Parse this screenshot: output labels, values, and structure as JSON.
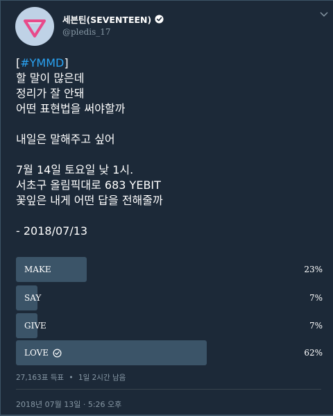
{
  "author": {
    "name": "세븐틴(SEVENTEEN)",
    "handle": "@pledis_17",
    "verified": true,
    "avatar_icon": "seventeen-triangle-logo-icon",
    "avatar_background": "#bfd2e6",
    "logo_color": "#e84a8a"
  },
  "menu": {
    "icon": "chevron-down-icon"
  },
  "tweet": {
    "hashtag_open": "[",
    "hashtag": "#YMMD",
    "hashtag_close": "]",
    "lines": [
      "할 말이 많은데",
      "정리가 잘 안돼",
      "어떤 표현법을 써야할까",
      "",
      "내일은 말해주고 싶어",
      "",
      "7월 14일 토요일 낮 1시.",
      "서초구 올림픽대로 683 YEBIT",
      "꽃잎은 내게 어떤 답을 전해줄까",
      "",
      "- 2018/07/13"
    ]
  },
  "poll": {
    "options": [
      {
        "label": "MAKE",
        "percent_text": "23%",
        "percent": 23,
        "selected": false
      },
      {
        "label": "SAY",
        "percent_text": "7%",
        "percent": 7,
        "selected": false
      },
      {
        "label": "GIVE",
        "percent_text": "7%",
        "percent": 7,
        "selected": false
      },
      {
        "label": "LOVE",
        "percent_text": "62%",
        "percent": 62,
        "selected": true
      }
    ],
    "votes": "27,163표 득표",
    "separator": "•",
    "time_left": "1일 2시간 남음",
    "bar_color": "#3b5468"
  },
  "timestamp": "2018년 07월 13일 · 5:26 오후",
  "colors": {
    "background": "#1c2938",
    "accent": "#2aa4f4",
    "muted_text": "#8899a6"
  }
}
